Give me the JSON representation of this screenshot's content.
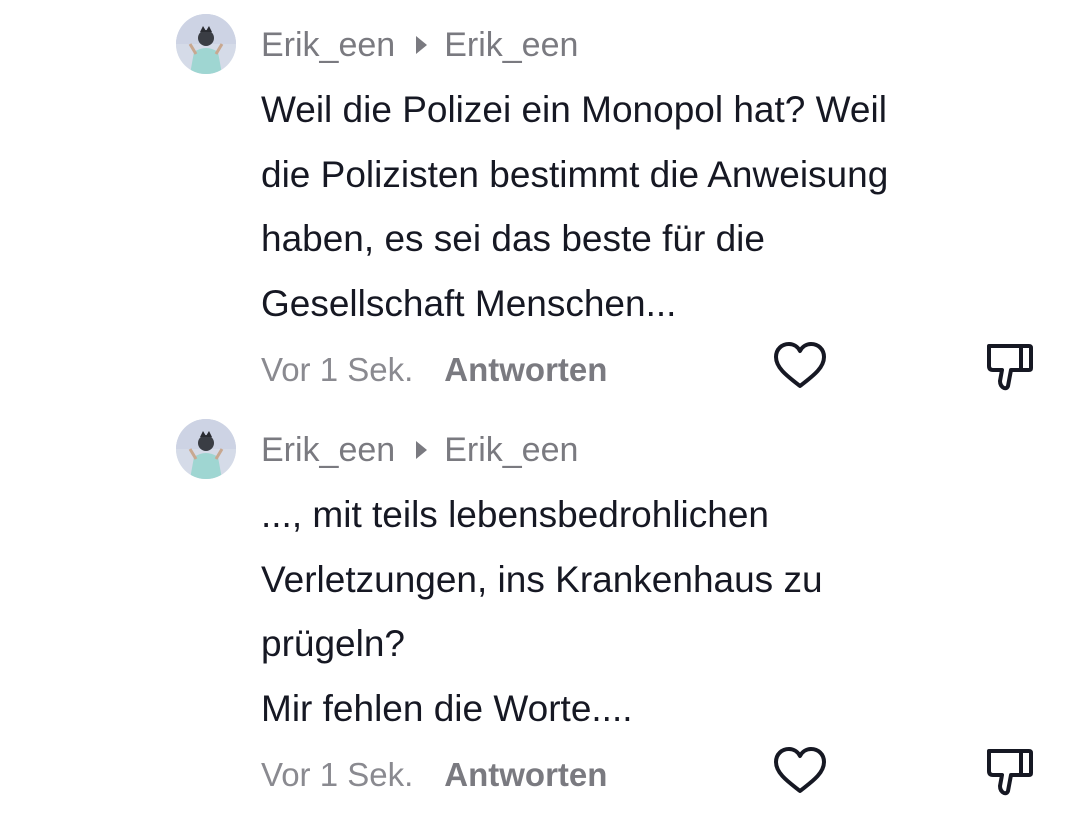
{
  "comments": [
    {
      "author": "Erik_een",
      "reply_to": "Erik_een",
      "text_lines": [
        "Weil die Polizei ein Monopol hat? Weil",
        "die Polizisten bestimmt die Anweisung",
        "haben, es sei das beste für die",
        "Gesellschaft Menschen..."
      ],
      "time": "Vor 1 Sek.",
      "reply_label": "Antworten",
      "like_icon": "heart-icon",
      "dislike_icon": "thumbs-down-icon"
    },
    {
      "author": "Erik_een",
      "reply_to": "Erik_een",
      "text_lines": [
        "..., mit teils lebensbedrohlichen",
        "Verletzungen, ins Krankenhaus zu",
        "prügeln?",
        "Mir fehlen die Worte...."
      ],
      "time": "Vor 1 Sek.",
      "reply_label": "Antworten",
      "like_icon": "heart-icon",
      "dislike_icon": "thumbs-down-icon"
    }
  ],
  "colors": {
    "text": "#161823",
    "muted": "#7a7a80",
    "icon": "#161823"
  }
}
